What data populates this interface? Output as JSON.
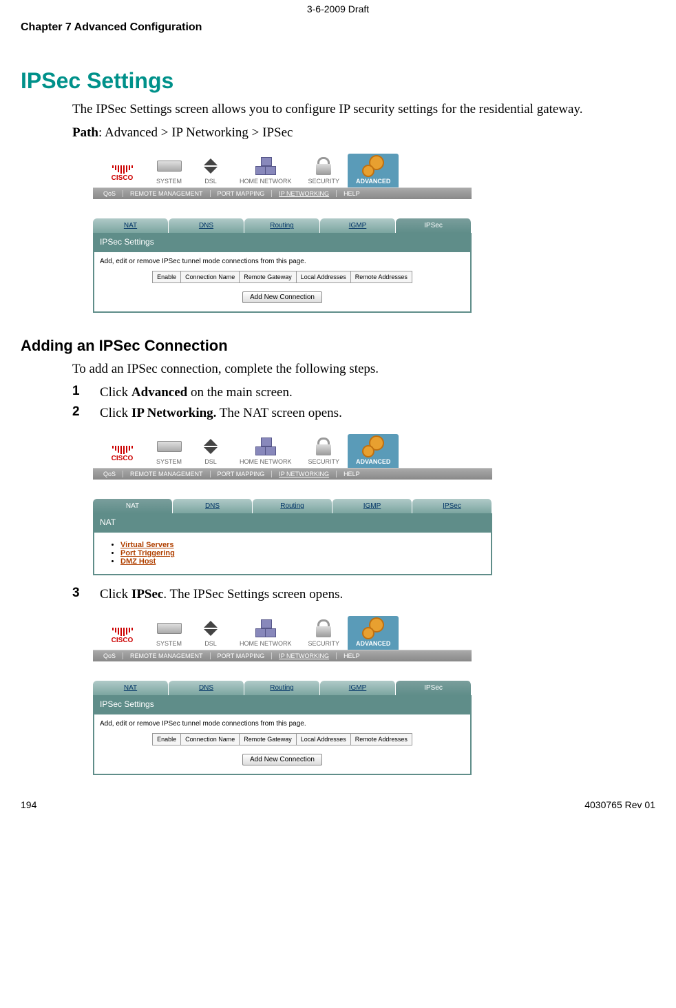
{
  "meta": {
    "draft": "3-6-2009 Draft",
    "chapter": "Chapter 7    Advanced Configuration",
    "page_num": "194",
    "doc_rev": "4030765 Rev 01"
  },
  "section": {
    "title": "IPSec Settings",
    "intro": "The IPSec Settings screen allows you to configure IP security settings for the residential gateway.",
    "path_label": "Path",
    "path_value": ":  Advanced > IP Networking > IPSec"
  },
  "subsection": {
    "title": "Adding an IPSec Connection",
    "intro": "To add an IPSec connection, complete the following steps.",
    "steps": [
      {
        "num": "1",
        "pre": "Click ",
        "bold": "Advanced",
        "post": " on the main screen."
      },
      {
        "num": "2",
        "pre": "Click ",
        "bold": "IP Networking.",
        "post": " The NAT screen opens."
      },
      {
        "num": "3",
        "pre": "Click ",
        "bold": "IPSec",
        "post": ".  The IPSec Settings screen opens."
      }
    ]
  },
  "ui": {
    "logo": "CISCO",
    "topnav": [
      "SYSTEM",
      "DSL",
      "HOME NETWORK",
      "SECURITY",
      "ADVANCED"
    ],
    "subnav": [
      "QoS",
      "REMOTE MANAGEMENT",
      "PORT MAPPING",
      "IP NETWORKING",
      "HELP"
    ],
    "tabs": [
      "NAT",
      "DNS",
      "Routing",
      "IGMP",
      "IPSec"
    ],
    "ipsec": {
      "header": "IPSec Settings",
      "note": "Add, edit or remove IPSec tunnel mode connections from this page.",
      "cols": [
        "Enable",
        "Connection Name",
        "Remote Gateway",
        "Local Addresses",
        "Remote Addresses"
      ],
      "button": "Add New Connection"
    },
    "nat": {
      "header": "NAT",
      "links": [
        "Virtual Servers",
        "Port Triggering",
        "DMZ Host"
      ]
    }
  }
}
